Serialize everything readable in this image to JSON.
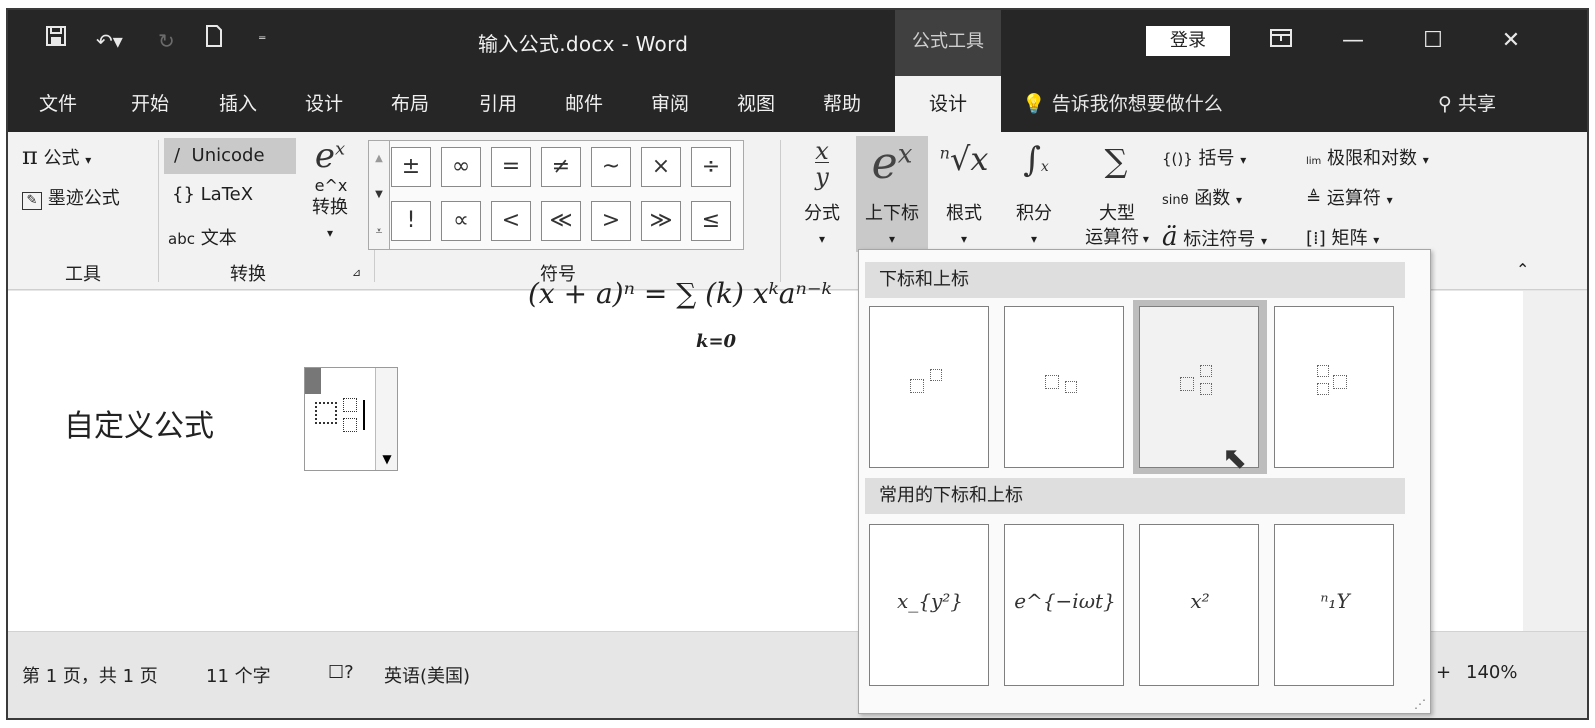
{
  "titlebar": {
    "doc_title": "输入公式.docx  -  Word",
    "context_tools": "公式工具",
    "signin": "登录"
  },
  "tabs": [
    "文件",
    "开始",
    "插入",
    "设计",
    "布局",
    "引用",
    "邮件",
    "审阅",
    "视图",
    "帮助",
    "设计"
  ],
  "tell_me": "告诉我你想要做什么",
  "share": "共享",
  "ribbon": {
    "tools": {
      "equation": "公式",
      "ink_equation": "墨迹公式",
      "label": "工具"
    },
    "convert": {
      "unicode": "Unicode",
      "latex": "LaTeX",
      "text": "文本",
      "text_prefix": "abc",
      "convert_btn": "转换",
      "convert_icon_sub": "e^x",
      "label": "转换"
    },
    "symbols": {
      "row1": [
        "±",
        "∞",
        "=",
        "≠",
        "~",
        "×",
        "÷"
      ],
      "row2": [
        "!",
        "∝",
        "<",
        "≪",
        ">",
        "≫",
        "≤"
      ],
      "label": "符号"
    },
    "structures": {
      "fraction": "分式",
      "script": "上下标",
      "radical": "根式",
      "integral": "积分",
      "large_operator_1": "大型",
      "large_operator_2": "运算符",
      "bracket": "括号",
      "function": "函数",
      "function_prefix": "sinθ",
      "accent": "标注符号",
      "limit_log": "极限和对数",
      "operator": "运算符",
      "matrix": "矩阵"
    }
  },
  "document": {
    "custom_equation_label": "自定义公式",
    "formula_partial": "(x + a)ⁿ = ∑ (k) xᵏaⁿ⁻ᵏ",
    "formula_sub": "k=0"
  },
  "gallery": {
    "section1_title": "下标和上标",
    "section2_title": "常用的下标和上标",
    "common": [
      "x_{y²}",
      "e^{−iωt}",
      "x²",
      "ⁿ₁Y"
    ]
  },
  "status": {
    "page": "第 1 页，共 1 页",
    "words": "11 个字",
    "language": "英语(美国)",
    "zoom": "140%",
    "zoom_plus": "+"
  }
}
